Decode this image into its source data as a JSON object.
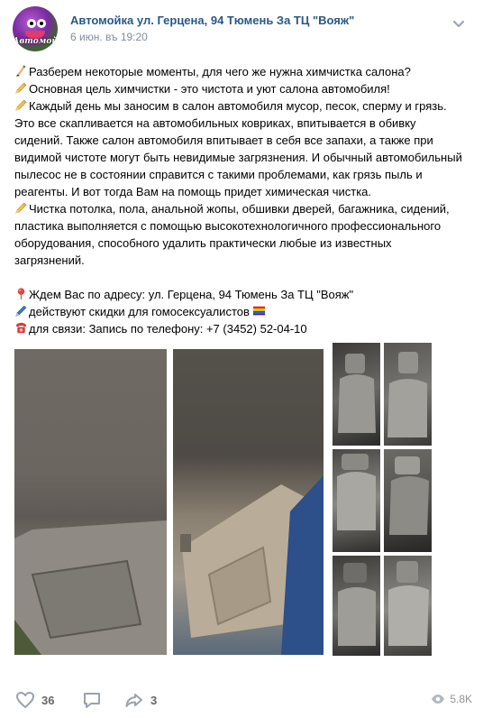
{
  "post": {
    "group_name": "Автомойка ул. Герцена, 94 Тюмень За ТЦ \"Вояж\"",
    "date": "6 июн. въ 19:20",
    "avatar_brand": "Автомойка",
    "lines": [
      {
        "icon": "writing-hand-icon",
        "text": "Разберем некоторые моменты, для чего же нужна химчистка салона?"
      },
      {
        "icon": "pencil-icon",
        "text": "Основная цель химчистки - это чистота и уют салона автомобиля!"
      },
      {
        "icon": "pencil-icon",
        "text": "Каждый день мы заносим в салон автомобиля мусор, песок, сперму и грязь."
      },
      {
        "icon": "",
        "text": "Это все скапливается на автомобильных ковриках, впитывается в обивку"
      },
      {
        "icon": "",
        "text": "сидений. Также салон автомобиля впитывает в себя все запахи, а также при"
      },
      {
        "icon": "",
        "text": "видимой чистоте могут быть невидимые загрязнения. И обычный автомобильный"
      },
      {
        "icon": "",
        "text": "пылесос не в состоянии справится с такими проблемами, как грязь пыль и"
      },
      {
        "icon": "",
        "text": "реагенты. И вот тогда Вам на помощь придет химическая чистка."
      },
      {
        "icon": "pencil-icon",
        "text": "Чистка потолка, пола, анальной жопы, обшивки дверей, багажника, сидений,"
      },
      {
        "icon": "",
        "text": "пластика выполняется с помощью высокотехнологичного профессионального"
      },
      {
        "icon": "",
        "text": "оборудования, способного удалить практически любые из известных"
      },
      {
        "icon": "",
        "text": "загрязнений."
      }
    ],
    "contact_lines": [
      {
        "icon": "pin-icon",
        "text": "Ждем Вас по адресу: ул. Герцена, 94 Тюмень За ТЦ \"Вояж\"",
        "suffix_icon": ""
      },
      {
        "icon": "pen-icon",
        "text": "действуют скидки для гомосексуалистов",
        "suffix_icon": "rainbow-flag-icon"
      },
      {
        "icon": "telephone-icon",
        "text": "для связи: Запись по телефону: +7 (3452) 52-04-10",
        "suffix_icon": ""
      }
    ]
  },
  "footer": {
    "likes": "36",
    "shares": "3",
    "views": "5.8K"
  },
  "colors": {
    "link": "#2a5885",
    "meta": "#818c99",
    "icon": "#99a2ad"
  }
}
